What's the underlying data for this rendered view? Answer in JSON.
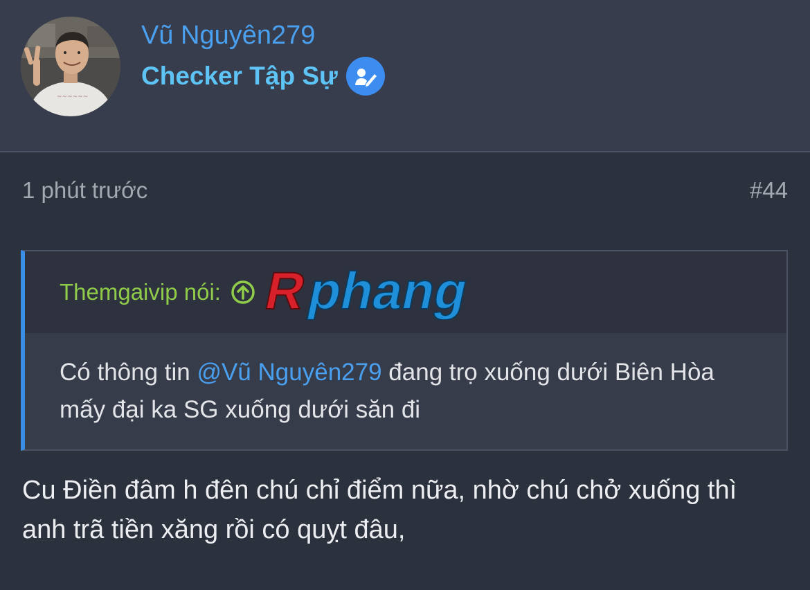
{
  "user": {
    "name": "Vũ Nguyên279",
    "title": "Checker Tập Sự",
    "badge_icon": "verified-checker-icon"
  },
  "post": {
    "time": "1 phút trước",
    "number": "#44"
  },
  "quote": {
    "author_label": "Themgaivip nói:",
    "arrow_icon": "arrow-up-circle-icon",
    "logo_text": "Rphang",
    "body_before": "Có thông tin ",
    "mention": "@Vũ Nguyên279",
    "body_after": " đang trọ xuống dưới Biên Hòa mấy đại ka SG xuống dưới săn đi"
  },
  "message": "Cu Điền đâm h đên chú chỉ điểm nữa, nhờ chú chở xuống thì anh trã tiền xăng rồi có quỵt đâu,",
  "colors": {
    "background": "#2c313e",
    "header": "#373d4c",
    "username": "#4aa0ef",
    "title": "#5dc4f5",
    "quote_author": "#90cc4a",
    "quote_accent": "#3a8ee6",
    "logo_red": "#d8202a",
    "logo_blue": "#1e8fd8"
  }
}
